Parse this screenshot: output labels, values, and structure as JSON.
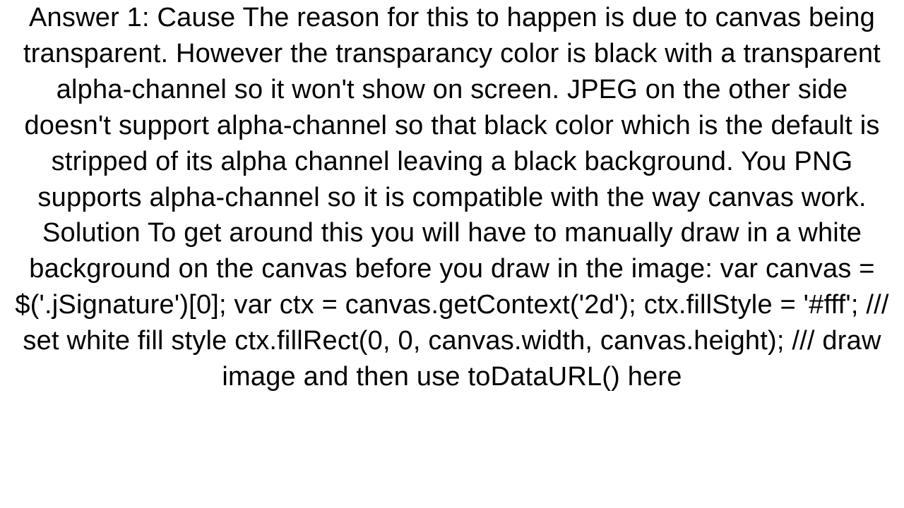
{
  "answer": {
    "text": "Answer 1: Cause The reason for this to happen is due to canvas being transparent. However the transparancy color is black with a transparent alpha-channel so it won't show on screen. JPEG on the other side doesn't support alpha-channel so that black color which is the default is stripped of its alpha channel leaving a black background. You PNG supports alpha-channel so it is compatible with the way canvas work. Solution To get around this you will have to manually draw in a white background on the canvas before you draw in the image: var canvas =  $('.jSignature')[0]; var ctx = canvas.getContext('2d');  ctx.fillStyle = '#fff';  /// set white fill style ctx.fillRect(0, 0, canvas.width, canvas.height);  /// draw image and then use toDataURL() here"
  }
}
